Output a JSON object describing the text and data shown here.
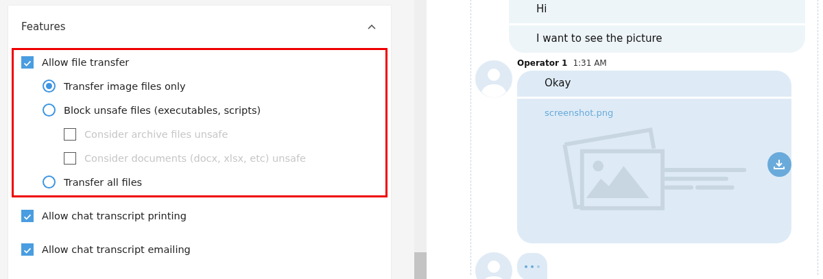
{
  "settings_card": {
    "title": "Features",
    "expanded": true,
    "items": [
      {
        "kind": "checkbox",
        "label": "Allow file transfer",
        "checked": true,
        "highlighted": true,
        "children": [
          {
            "kind": "radio",
            "label": "Transfer image files only",
            "selected": true
          },
          {
            "kind": "radio",
            "label": "Block unsafe files (executables, scripts)",
            "selected": false,
            "children": [
              {
                "kind": "checkbox",
                "label": "Consider archive files unsafe",
                "checked": false,
                "disabled": true
              },
              {
                "kind": "checkbox",
                "label": "Consider documents (docx, xlsx, etc) unsafe",
                "checked": false,
                "disabled": true
              }
            ]
          },
          {
            "kind": "radio",
            "label": "Transfer all files",
            "selected": false
          }
        ]
      },
      {
        "kind": "checkbox",
        "label": "Allow chat transcript printing",
        "checked": true,
        "highlighted": false
      },
      {
        "kind": "checkbox",
        "label": "Allow chat transcript emailing",
        "checked": true,
        "highlighted": false
      }
    ]
  },
  "chat": {
    "visitor_messages": [
      "Hi",
      "I want to see the picture"
    ],
    "operator": {
      "name": "Operator 1",
      "time": "1:31 AM",
      "message": "Okay",
      "attachment": "screenshot.png"
    },
    "typing": true
  }
}
